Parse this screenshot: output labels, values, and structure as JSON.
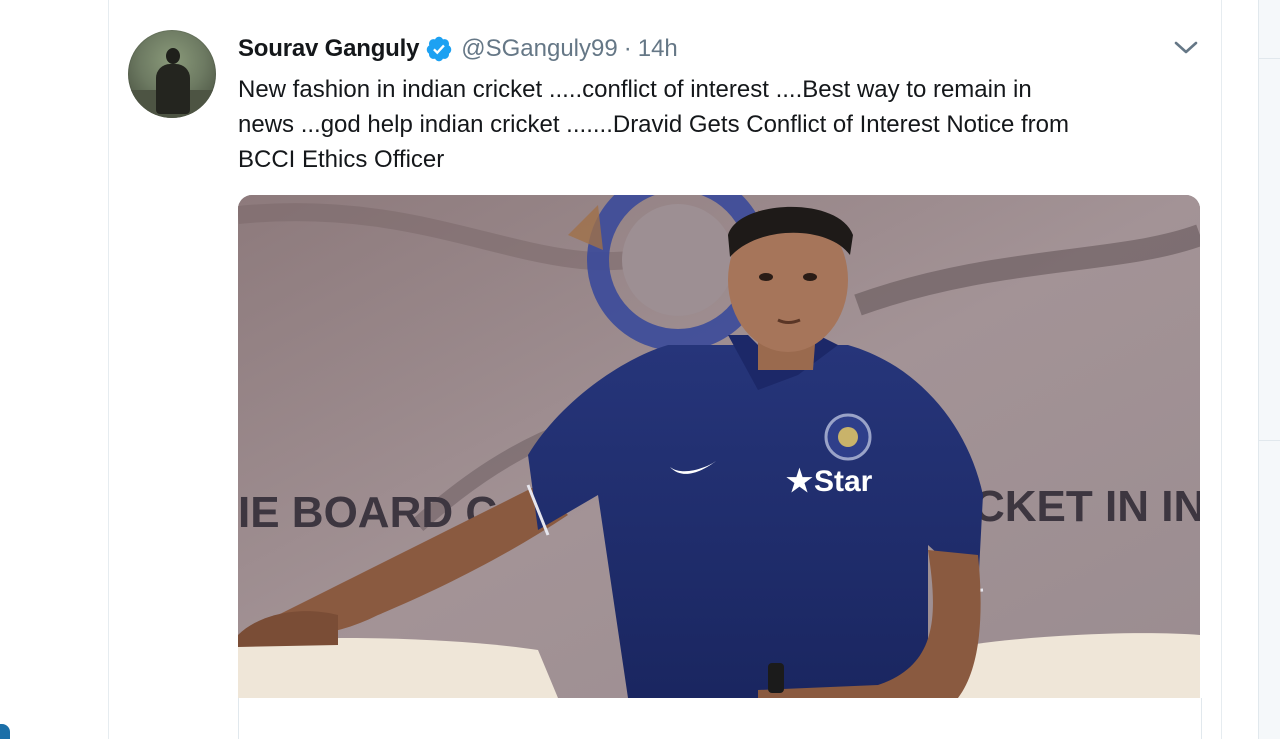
{
  "tweet": {
    "display_name": "Sourav Ganguly",
    "handle": "@SGanguly99",
    "separator": "·",
    "timestamp": "14h",
    "text": "New fashion in indian cricket .....conflict of interest ....Best way to remain in\nnews ...god help indian cricket .......Dravid Gets Conflict of Interest Notice from\nBCCI Ethics Officer",
    "verified": true
  },
  "media": {
    "banner_text_left": "IE BOARD C",
    "banner_text_right": "CKET IN IN",
    "shirt_sponsor": "Star"
  },
  "icons": {
    "verified": "verified-badge-icon",
    "menu": "chevron-down-icon"
  },
  "colors": {
    "name": "#14171a",
    "secondary": "#657786",
    "verified_blue": "#1da1f2",
    "jersey_blue": "#1f2f6b",
    "backdrop": "#8b7c80"
  }
}
